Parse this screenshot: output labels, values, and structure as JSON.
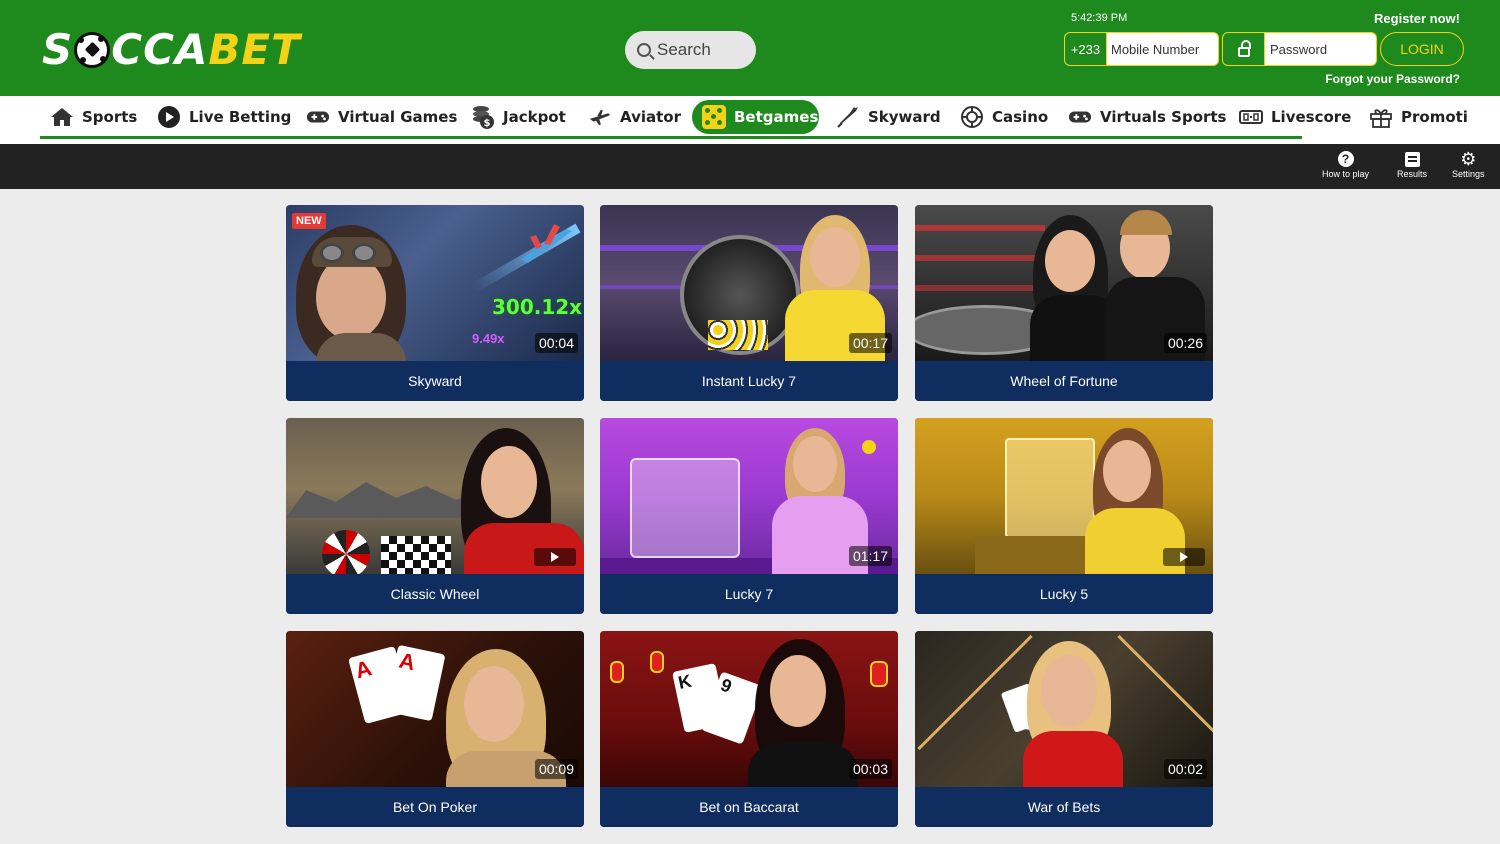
{
  "header": {
    "logo": {
      "part1": "S",
      "part2": "CCA",
      "part3": "BET"
    },
    "search_placeholder": "Search",
    "time": "5:42:39 PM",
    "register": "Register now!",
    "phone_prefix": "+233",
    "phone_placeholder": "Mobile Number",
    "password_placeholder": "Password",
    "login": "LOGIN",
    "forgot": "Forgot your Password?"
  },
  "nav": {
    "items": [
      {
        "label": "Sports",
        "icon": "home-icon"
      },
      {
        "label": "Live Betting",
        "icon": "play-circle-icon"
      },
      {
        "label": "Virtual Games",
        "icon": "gamepad-icon"
      },
      {
        "label": "Jackpot",
        "icon": "coins-icon"
      },
      {
        "label": "Aviator",
        "icon": "plane-icon"
      },
      {
        "label": "Betgames",
        "icon": "dice-icon"
      },
      {
        "label": "Skyward",
        "icon": "rocket-icon"
      },
      {
        "label": "Casino",
        "icon": "casino-chip-icon"
      },
      {
        "label": "Virtuals Sports",
        "icon": "gamepad-icon"
      },
      {
        "label": "Livescore",
        "icon": "scoreboard-icon"
      },
      {
        "label": "Promoti",
        "icon": "gift-icon"
      }
    ],
    "active": "Betgames"
  },
  "toolbar": {
    "how_to_play": "How to play",
    "results": "Results",
    "settings": "Settings"
  },
  "games": [
    {
      "title": "Skyward",
      "timer": "00:04",
      "badge": "NEW",
      "multiplier": "300.12x",
      "sub_multiplier": "9.49x"
    },
    {
      "title": "Instant Lucky 7",
      "timer": "00:17"
    },
    {
      "title": "Wheel of Fortune",
      "timer": "00:26"
    },
    {
      "title": "Classic Wheel",
      "timer": ""
    },
    {
      "title": "Lucky 7",
      "timer": "01:17"
    },
    {
      "title": "Lucky 5",
      "timer": ""
    },
    {
      "title": "Bet On Poker",
      "timer": "00:09"
    },
    {
      "title": "Bet on Baccarat",
      "timer": "00:03"
    },
    {
      "title": "War of Bets",
      "timer": "00:02"
    }
  ],
  "colors": {
    "brand_green": "#1e8a1e",
    "brand_yellow": "#f4d218",
    "card_navy": "#0f2d5e",
    "toolbar_black": "#222222"
  }
}
